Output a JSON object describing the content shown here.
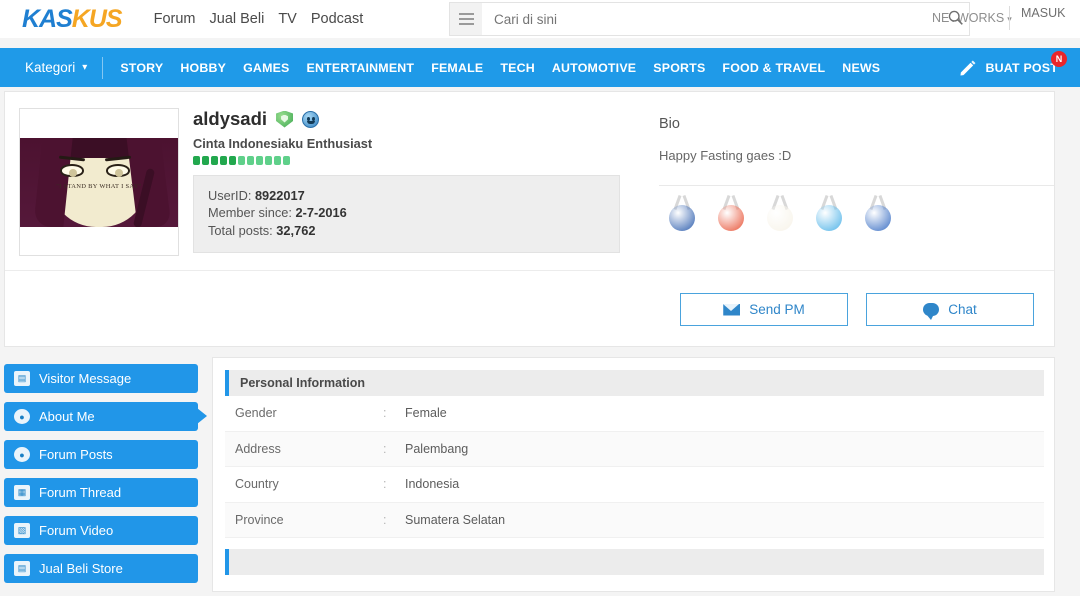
{
  "header": {
    "logo_kas": "KAS",
    "logo_kus": "KUS",
    "nav": [
      {
        "label": "Forum"
      },
      {
        "label": "Jual Beli"
      },
      {
        "label": "TV"
      },
      {
        "label": "Podcast"
      }
    ],
    "search_placeholder": "Cari di sini",
    "search_value": "",
    "networks_label": "NETWORKS",
    "networks_chevron": "▾",
    "login_label": "MASUK",
    "hamburger_icon": "hamburger-icon",
    "search_icon": "search-icon"
  },
  "catnav": {
    "kategori_label": "Kategori",
    "kategori_chevron": "▾",
    "links": [
      {
        "label": "STORY"
      },
      {
        "label": "HOBBY"
      },
      {
        "label": "GAMES"
      },
      {
        "label": "ENTERTAINMENT"
      },
      {
        "label": "FEMALE"
      },
      {
        "label": "TECH"
      },
      {
        "label": "AUTOMOTIVE"
      },
      {
        "label": "SPORTS"
      },
      {
        "label": "FOOD & TRAVEL"
      },
      {
        "label": "NEWS"
      }
    ],
    "create_post_label": "BUAT POST",
    "create_post_badge": "N",
    "pencil_icon": "pencil-icon"
  },
  "profile": {
    "avatar_quote": "\"I STAND BY WHAT I SAY\"",
    "username": "aldysadi",
    "badges": [
      {
        "name": "shield-badge"
      },
      {
        "name": "smiley-badge"
      }
    ],
    "subtitle": "Cinta Indonesiaku Enthusiast",
    "reputation_dots": [
      {
        "color": "#22a84e"
      },
      {
        "color": "#22a84e"
      },
      {
        "color": "#22a84e"
      },
      {
        "color": "#22a84e"
      },
      {
        "color": "#22a84e"
      },
      {
        "color": "#5fd08a"
      },
      {
        "color": "#5fd08a"
      },
      {
        "color": "#5fd08a"
      },
      {
        "color": "#5fd08a"
      },
      {
        "color": "#5fd08a"
      },
      {
        "color": "#5fd08a"
      }
    ],
    "stats": {
      "userid_label": "UserID:",
      "userid_value": "8922017",
      "member_since_label": "Member since:",
      "member_since_value": "2-7-2016",
      "total_posts_label": "Total posts:",
      "total_posts_value": "32,762"
    }
  },
  "bio": {
    "title": "Bio",
    "text": "Happy Fasting gaes :D",
    "medals": [
      {
        "name": "medal-blue-purple",
        "color": "#2f5fae"
      },
      {
        "name": "medal-orange-red",
        "color": "#e8563a"
      },
      {
        "name": "medal-white-circle",
        "color": "#f7f3e8"
      },
      {
        "name": "medal-light-blue",
        "color": "#4fb3e8"
      },
      {
        "name": "medal-blue-red",
        "color": "#3a6fc4"
      }
    ]
  },
  "actions": {
    "send_pm_label": "Send PM",
    "send_pm_icon": "envelope-icon",
    "chat_label": "Chat",
    "chat_icon": "chat-bubble-icon"
  },
  "sidebar": {
    "items": [
      {
        "label": "Visitor Message",
        "icon": "note-icon",
        "glyph": "▤",
        "active": false
      },
      {
        "label": "About Me",
        "icon": "person-icon",
        "glyph": "●",
        "active": true
      },
      {
        "label": "Forum Posts",
        "icon": "comment-icon",
        "glyph": "●",
        "active": false
      },
      {
        "label": "Forum Thread",
        "icon": "calendar-icon",
        "glyph": "▦",
        "active": false
      },
      {
        "label": "Forum Video",
        "icon": "clapperboard-icon",
        "glyph": "▧",
        "active": false
      },
      {
        "label": "Jual Beli Store",
        "icon": "store-icon",
        "glyph": "▤",
        "active": false
      }
    ]
  },
  "personal_information": {
    "section_title": "Personal Information",
    "colon": ":",
    "rows": [
      {
        "label": "Gender",
        "value": "Female"
      },
      {
        "label": "Address",
        "value": "Palembang"
      },
      {
        "label": "Country",
        "value": "Indonesia"
      },
      {
        "label": "Province",
        "value": "Sumatera Selatan"
      }
    ]
  },
  "colors": {
    "brand_blue": "#1f9ae8",
    "brand_orange": "#f5a623",
    "accent_blue": "#2196e8",
    "badge_red": "#e8252a"
  }
}
